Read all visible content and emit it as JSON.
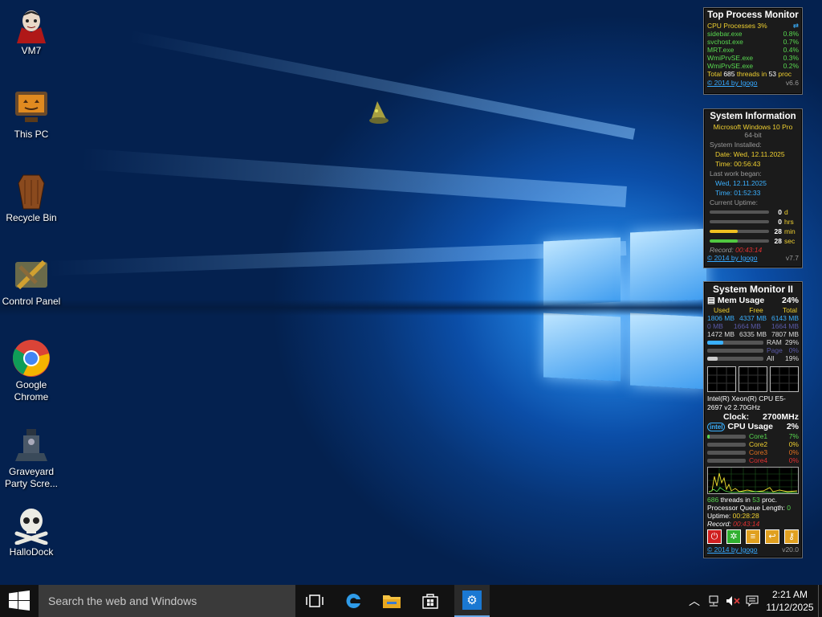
{
  "desktop": {
    "icons": [
      {
        "label": "VM7",
        "icon": "vampire-avatar-icon"
      },
      {
        "label": "This PC",
        "icon": "pumpkin-monitor-icon"
      },
      {
        "label": "Recycle Bin",
        "icon": "coffin-bin-icon"
      },
      {
        "label": "Control Panel",
        "icon": "control-panel-icon"
      },
      {
        "label": "Google Chrome",
        "icon": "chrome-icon"
      },
      {
        "label": "Graveyard Party Scre...",
        "icon": "graveyard-icon"
      },
      {
        "label": "HalloDock",
        "icon": "skull-crossbones-icon"
      }
    ]
  },
  "top_process": {
    "title": "Top Process Monitor",
    "header": "CPU Processes 3%",
    "processes": [
      {
        "name": "sidebar.exe",
        "pct": "0.8%"
      },
      {
        "name": "svchost.exe",
        "pct": "0.7%"
      },
      {
        "name": "MRT.exe",
        "pct": "0.4%"
      },
      {
        "name": "WmiPrvSE.exe",
        "pct": "0.3%"
      },
      {
        "name": "WmiPrvSE.exe",
        "pct": "0.2%"
      }
    ],
    "total_a": "Total ",
    "total_threads": "685",
    "total_b": " threads in ",
    "total_procs": "53",
    "total_c": " proc",
    "credit": "© 2014 by Igogo",
    "version": "v6.6"
  },
  "sysinfo": {
    "title": "System Information",
    "os": "Microsoft Windows 10 Pro",
    "arch": "64-bit",
    "installed_label": "System Installed:",
    "date_line": "Date: Wed, 12.11.2025",
    "time_line": "Time: 00:56:43",
    "last_work_label": "Last work began:",
    "last_date": "Wed, 12.11.2025",
    "last_time": "Time: 01:52:33",
    "uptime_label": "Current Uptime:",
    "uptime": [
      {
        "value": "0",
        "unit": "d",
        "fill": 0,
        "color": "#555555"
      },
      {
        "value": "0",
        "unit": "hrs",
        "fill": 0,
        "color": "#555555"
      },
      {
        "value": "28",
        "unit": "min",
        "fill": 0.47,
        "color": "#f0c020"
      },
      {
        "value": "28",
        "unit": "sec",
        "fill": 0.47,
        "color": "#50c840"
      }
    ],
    "record_label": "Record:",
    "record_value": "00:43:14",
    "credit": "© 2014 by Igogo",
    "version": "v7.7"
  },
  "sysmon": {
    "title": "System Monitor II",
    "mem_label": "Mem Usage",
    "mem_pct": "24%",
    "col_used": "Used",
    "col_free": "Free",
    "col_total": "Total",
    "mem_rows": [
      {
        "used": "1806 MB",
        "free": "4337 MB",
        "total": "6143 MB",
        "color": "#3ab0ff"
      },
      {
        "used": "0 MB",
        "free": "1664 MB",
        "total": "1664 MB",
        "color": "#5a5aa8"
      },
      {
        "used": "1472 MB",
        "free": "6335 MB",
        "total": "7807 MB",
        "color": "#dddddd"
      }
    ],
    "mem_bars": [
      {
        "label": "RAM",
        "pct": "29%",
        "fill": 0.29,
        "color": "#3ab0ff",
        "text": "#dddddd"
      },
      {
        "label": "Page",
        "pct": "0%",
        "fill": 0.0,
        "color": "#5a5aa8",
        "text": "#5a5aa8"
      },
      {
        "label": "All",
        "pct": "19%",
        "fill": 0.19,
        "color": "#cccccc",
        "text": "#dddddd"
      }
    ],
    "cpu_name": "Intel(R) Xeon(R) CPU E5-2697 v2 2.70GHz",
    "clock_label": "Clock:",
    "clock_value": "2700MHz",
    "cpu_label": "CPU Usage",
    "cpu_pct": "2%",
    "cores": [
      {
        "label": "Core1",
        "pct": "7%",
        "fill": 0.07,
        "color": "#58d850"
      },
      {
        "label": "Core2",
        "pct": "0%",
        "fill": 0.0,
        "color": "#f0d030"
      },
      {
        "label": "Core3",
        "pct": "0%",
        "fill": 0.0,
        "color": "#e07020"
      },
      {
        "label": "Core4",
        "pct": "0%",
        "fill": 0.0,
        "color": "#e03030"
      }
    ],
    "threads": "686",
    "threads_mid": " threads in ",
    "procs": "53",
    "procs_suffix": " proc.",
    "queue_label": "Processor Queue Length: ",
    "queue_value": "0",
    "uptime_label": "Uptime: ",
    "uptime_value": "00:28:28",
    "record_label": "Record: ",
    "record_value": "00:43:14",
    "credit": "© 2014 by Igogo",
    "version": "v20.0",
    "buttons": [
      "power-button",
      "restart-button",
      "hibernate-button",
      "logoff-button",
      "lock-button"
    ]
  },
  "taskbar": {
    "search_placeholder": "Search the web and Windows",
    "apps": [
      "task-view-icon",
      "edge-icon",
      "file-explorer-icon",
      "store-icon",
      "settings-icon"
    ],
    "time": "2:21 AM",
    "date": "11/12/2025"
  }
}
